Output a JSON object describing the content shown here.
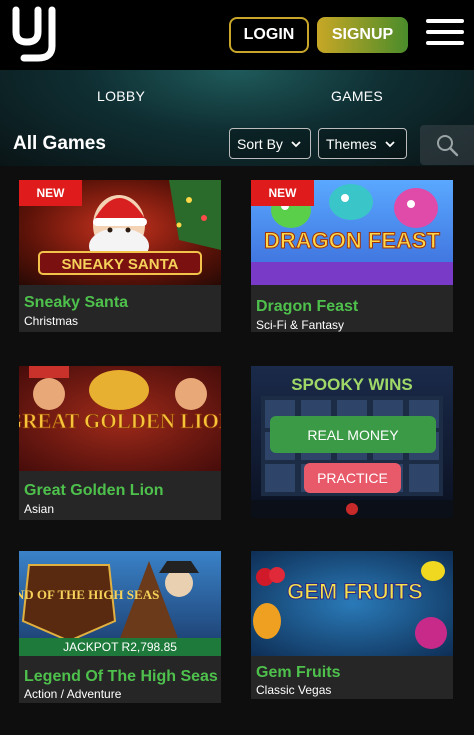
{
  "header": {
    "login_label": "LOGIN",
    "signup_label": "SIGNUP"
  },
  "nav": {
    "tabs": [
      "LOBBY",
      "GAMES"
    ],
    "section_title": "All Games",
    "sort_label": "Sort By",
    "themes_label": "Themes"
  },
  "games": [
    {
      "name": "Sneaky Santa",
      "theme": "Christmas",
      "badge": "NEW",
      "art_title": "SNEAKY SANTA"
    },
    {
      "name": "Dragon Feast",
      "theme": "Sci-Fi & Fantasy",
      "badge": "NEW",
      "art_title": "DRAGON FEAST"
    },
    {
      "name": "Great Golden Lion",
      "theme": "Asian",
      "art_title": "GREAT GOLDEN LION"
    },
    {
      "name": "Spooky Wins",
      "real_money_label": "REAL MONEY",
      "practice_label": "PRACTICE",
      "art_title": "SPOOKY WINS"
    },
    {
      "name": "Legend Of The High Seas",
      "theme": "Action / Adventure",
      "jackpot": "JACKPOT R2,798.85",
      "art_title": "LEGEND OF THE HIGH SEAS"
    },
    {
      "name": "Gem Fruits",
      "theme": "Classic Vegas",
      "art_title": "GEM FRUITS"
    }
  ],
  "colors": {
    "accent_green": "#4ec04c",
    "badge_red": "#e01b1b",
    "signup_gold": "#c8a726"
  }
}
